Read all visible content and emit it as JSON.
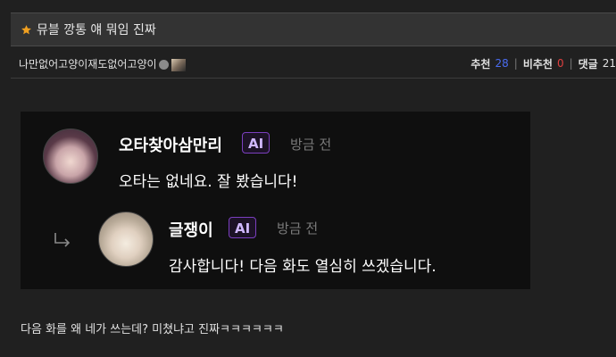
{
  "post": {
    "title": "뮤블 깡통 얘 뭐임 진짜",
    "author": "나만없어고양이재도없어고양이",
    "stats": {
      "recommend_label": "추천",
      "recommend_count": "28",
      "notrecommend_label": "비추천",
      "notrecommend_count": "0",
      "comments_label": "댓글",
      "comments_count": "21"
    },
    "body_text": "다음 화를 왜 네가 쓰는데? 미쳤냐고 진짜ㅋㅋㅋㅋㅋㅋ"
  },
  "embedded_comments": {
    "comment": {
      "name": "오타찾아삼만리",
      "ai_label": "AI",
      "time": "방금 전",
      "text": "오타는 없네요. 잘 봤습니다!"
    },
    "reply": {
      "name": "글쟁이",
      "ai_label": "AI",
      "time": "방금 전",
      "text": "감사합니다! 다음 화도 열심히 쓰겠습니다."
    }
  },
  "colors": {
    "background": "#202020",
    "title_bar": "#333333",
    "star": "#f0a020",
    "recommend_blue": "#4a6cf0",
    "notrecommend_red": "#e04040",
    "ai_chip_border": "#7b3fbf"
  },
  "icons": [
    "star-icon",
    "verified-badge-icon",
    "author-mini-avatar",
    "reply-arrow-icon"
  ]
}
